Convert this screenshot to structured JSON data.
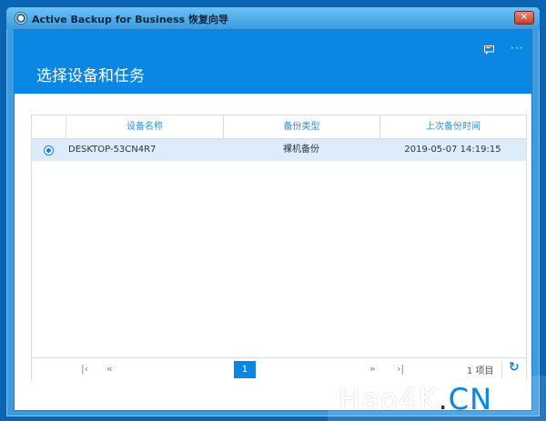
{
  "window": {
    "title": "Active Backup for Business 恢复向导",
    "close_symbol": "✕"
  },
  "header": {
    "title": "选择设备和任务",
    "feedback_icon": "feedback-icon",
    "more_symbol": "···"
  },
  "table": {
    "columns": [
      "设备名称",
      "备份类型",
      "上次备份时间"
    ],
    "rows": [
      {
        "selected": true,
        "device": "DESKTOP-53CN4R7",
        "type": "裸机备份",
        "last_backup": "2019-05-07 14:19:15"
      }
    ]
  },
  "pager": {
    "first_symbol": "|‹",
    "prev_symbol": "«",
    "next_symbol": "»",
    "last_symbol": "›|",
    "current_page": "1",
    "count_text": "1 项目",
    "refresh_symbol": "↻"
  },
  "watermark": {
    "part1": "Hao4K",
    "part2": ".",
    "part3": "CN"
  }
}
